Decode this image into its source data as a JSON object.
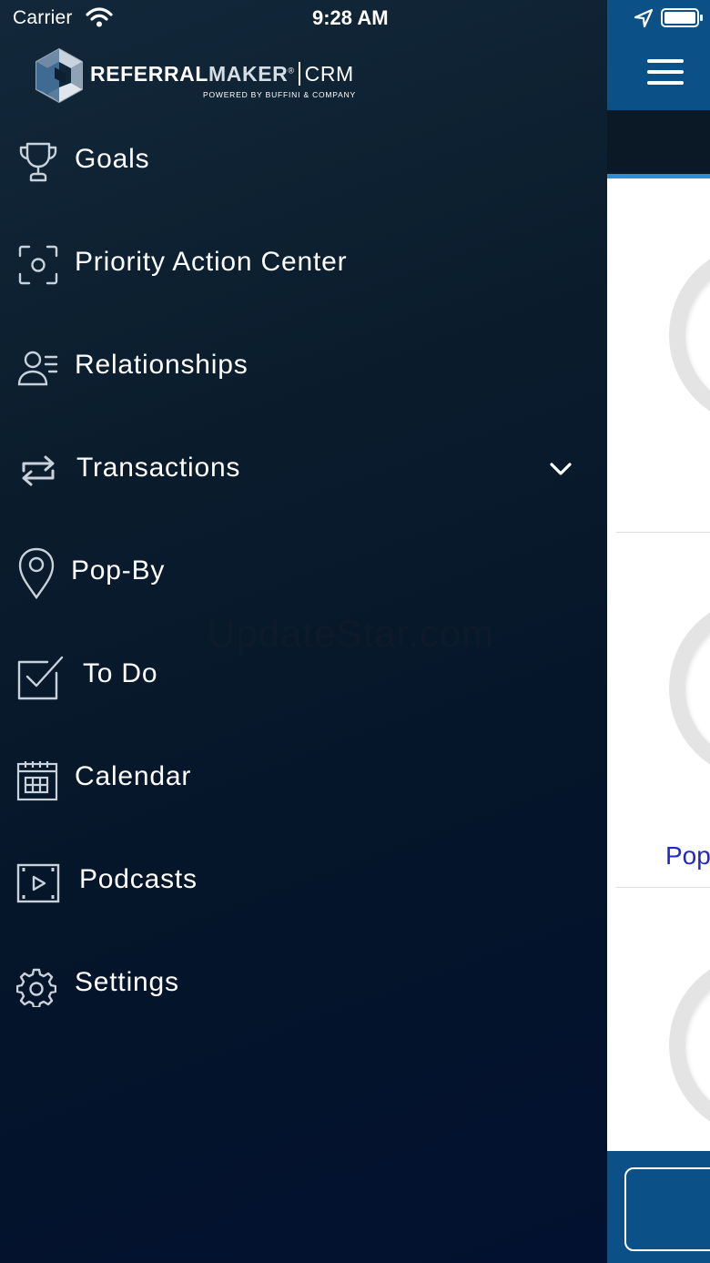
{
  "status_bar": {
    "carrier": "Carrier",
    "time": "9:28 AM"
  },
  "logo": {
    "brand_bold": "REFERRAL",
    "brand_maker": "MAKER",
    "registered": "®",
    "product": "CRM",
    "tagline": "POWERED BY BUFFINI & COMPANY"
  },
  "menu": {
    "items": [
      {
        "label": "Goals",
        "icon": "trophy-icon"
      },
      {
        "label": "Priority Action Center",
        "icon": "target-icon"
      },
      {
        "label": "Relationships",
        "icon": "person-list-icon"
      },
      {
        "label": "Transactions",
        "icon": "swap-arrows-icon",
        "expandable": true
      },
      {
        "label": "Pop-By",
        "icon": "map-pin-icon"
      },
      {
        "label": "To Do",
        "icon": "checkbox-icon"
      },
      {
        "label": "Calendar",
        "icon": "calendar-icon"
      },
      {
        "label": "Podcasts",
        "icon": "video-play-icon"
      },
      {
        "label": "Settings",
        "icon": "gear-icon"
      }
    ]
  },
  "background_app": {
    "partial_label": "Pop"
  },
  "watermark": "UpdateStar.com",
  "colors": {
    "drawer_bg": "#0a1c2c",
    "header_blue": "#0b5087",
    "accent_blue": "#2a8fd8",
    "link_blue": "#2227c9",
    "text": "#ffffff"
  }
}
